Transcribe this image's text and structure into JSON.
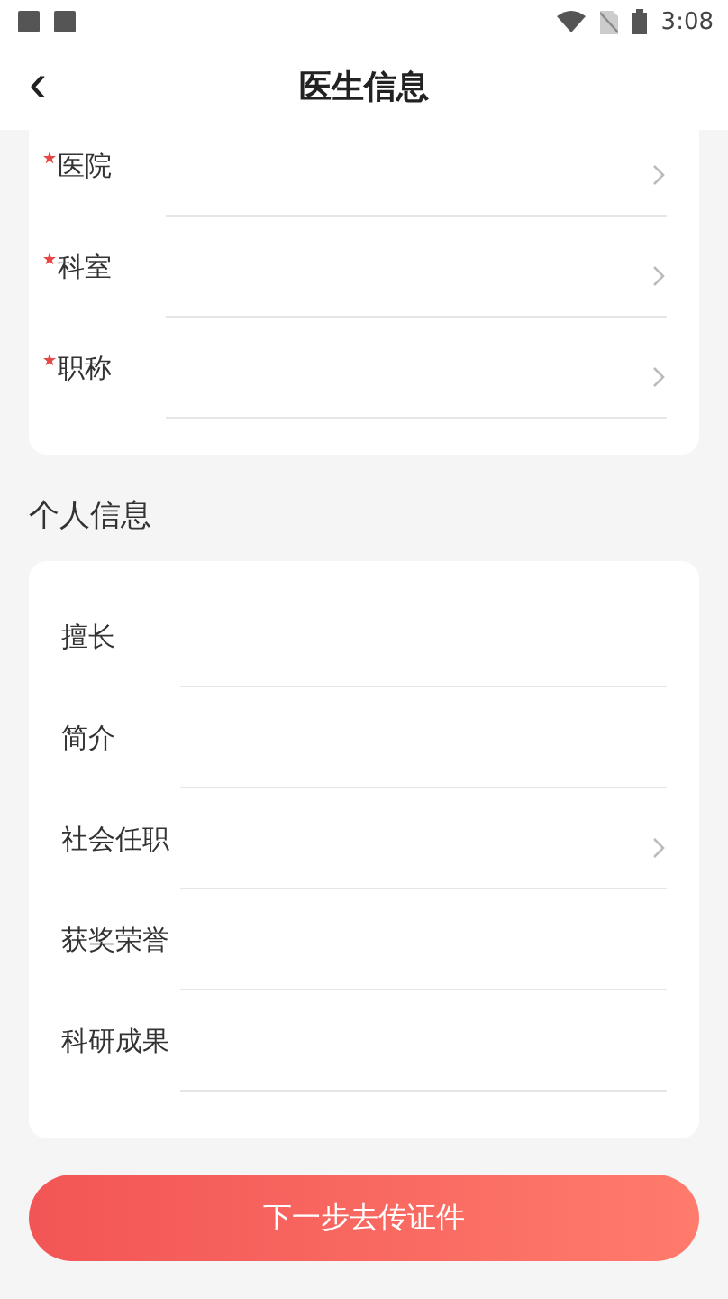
{
  "status_bar": {
    "time": "3:08"
  },
  "header": {
    "back_icon": "‹",
    "title": "医生信息"
  },
  "work_section": {
    "fields": [
      {
        "label": "医院",
        "required": true,
        "kind": "select"
      },
      {
        "label": "科室",
        "required": true,
        "kind": "select"
      },
      {
        "label": "职称",
        "required": true,
        "kind": "select"
      }
    ]
  },
  "personal_section": {
    "title": "个人信息",
    "fields": [
      {
        "label": "擅长",
        "required": false,
        "kind": "input"
      },
      {
        "label": "简介",
        "required": false,
        "kind": "input"
      },
      {
        "label": "社会任职",
        "required": false,
        "kind": "select"
      },
      {
        "label": "获奖荣誉",
        "required": false,
        "kind": "input"
      },
      {
        "label": "科研成果",
        "required": false,
        "kind": "input"
      }
    ]
  },
  "next_button": "下一步去传证件"
}
